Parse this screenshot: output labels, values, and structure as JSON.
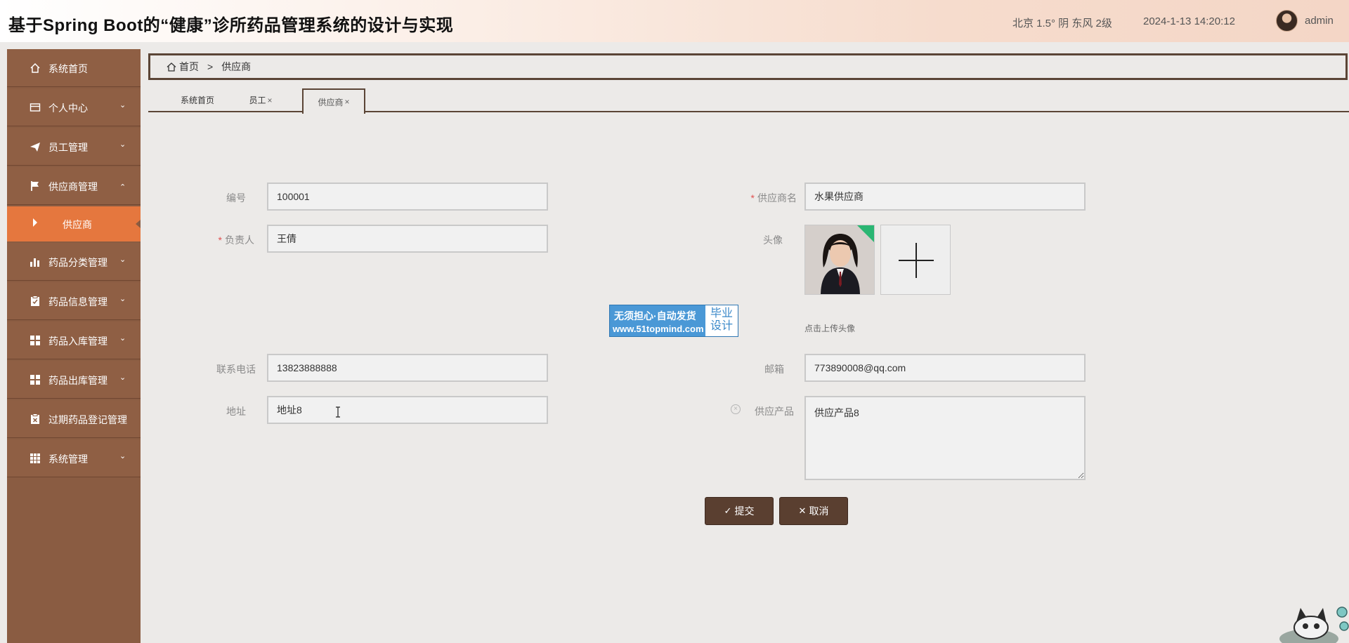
{
  "header": {
    "title": "基于Spring Boot的“健康”诊所药品管理系统的设计与实现",
    "weather": "北京  1.5°  阴  东风  2级",
    "datetime": "2024-1-13 14:20:12",
    "user": "admin"
  },
  "sidebar": {
    "items": [
      {
        "label": "系统首页",
        "icon": "home-icon"
      },
      {
        "label": "个人中心",
        "icon": "card-icon"
      },
      {
        "label": "员工管理",
        "icon": "send-icon"
      },
      {
        "label": "供应商管理",
        "icon": "flag-icon"
      },
      {
        "label": "供应商",
        "icon": "caret-right-icon"
      },
      {
        "label": "药品分类管理",
        "icon": "bar-chart-icon"
      },
      {
        "label": "药品信息管理",
        "icon": "clipboard-icon"
      },
      {
        "label": "药品入库管理",
        "icon": "grid-icon"
      },
      {
        "label": "药品出库管理",
        "icon": "grid-icon"
      },
      {
        "label": "过期药品登记管理",
        "icon": "clipboard-x-icon"
      },
      {
        "label": "系统管理",
        "icon": "apps-icon"
      }
    ]
  },
  "breadcrumb": {
    "home": "首页",
    "separator": ">",
    "current": "供应商"
  },
  "tabs": [
    {
      "label": "系统首页",
      "closable": false
    },
    {
      "label": "员工",
      "closable": true
    },
    {
      "label": "供应商",
      "closable": true,
      "active": true
    }
  ],
  "close_glyph": "×",
  "form": {
    "id_label": "编号",
    "id_value": "100001",
    "name_label": "供应商名",
    "name_value": "水果供应商",
    "owner_label": "负责人",
    "owner_value": "王倩",
    "avatar_label": "头像",
    "upload_hint": "点击上传头像",
    "phone_label": "联系电话",
    "phone_value": "13823888888",
    "email_label": "邮箱",
    "email_value": "773890008@qq.com",
    "address_label": "地址",
    "address_value": "地址8",
    "product_label": "供应产品",
    "product_value": "供应产品8",
    "required_mark": "*"
  },
  "buttons": {
    "submit": "提交",
    "cancel": "取消"
  },
  "watermark": {
    "line1": "无须担心·自动发货",
    "line2": "www.51topmind.com",
    "badge_line1": "毕业",
    "badge_line2": "设计"
  },
  "colors": {
    "sidebar": "#8a5c42",
    "active_nav": "#e5773e",
    "button": "#5a3f30",
    "border": "#5b4536"
  }
}
